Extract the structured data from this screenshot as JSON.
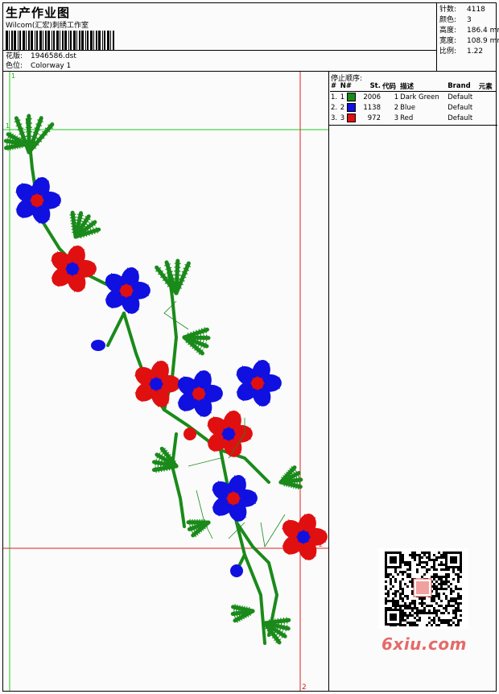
{
  "header": {
    "title": "生产作业图",
    "company": "Wilcom(汇宏)刺绣工作室",
    "design_label": "花版:",
    "design_value": "1946586.dst",
    "colorway_label": "色位:",
    "colorway_value": "Colorway 1"
  },
  "stats": [
    {
      "label": "针数:",
      "value": "4118"
    },
    {
      "label": "颜色:",
      "value": "3"
    },
    {
      "label": "高度:",
      "value": "186.4 mm"
    },
    {
      "label": "宽度:",
      "value": "108.9 mm"
    },
    {
      "label": "比例:",
      "value": "1.22"
    }
  ],
  "stop_sequence": {
    "title": "停止顺序:",
    "columns": [
      "#",
      "N#",
      "St.",
      "代码",
      "描述",
      "Brand",
      "元素"
    ],
    "rows": [
      {
        "idx": "1.",
        "n": "1",
        "color": "#1a8a1a",
        "st": "2006",
        "code": "1",
        "desc": "Dark Green",
        "brand": "Default"
      },
      {
        "idx": "2.",
        "n": "2",
        "color": "#1010e0",
        "st": "1138",
        "code": "2",
        "desc": "Blue",
        "brand": "Default"
      },
      {
        "idx": "3.",
        "n": "3",
        "color": "#e01010",
        "st": "972",
        "code": "3",
        "desc": "Red",
        "brand": "Default"
      }
    ]
  },
  "canvas": {
    "marker_1": "1",
    "marker_2": "2",
    "marker_1b": "1",
    "marker_2b": "2"
  },
  "watermark": "6xiu.com",
  "colors": {
    "green": "#1a8a1a",
    "blue": "#1010e0",
    "red": "#e01010",
    "guide_green": "#22cc22",
    "guide_red": "#dd2222"
  }
}
